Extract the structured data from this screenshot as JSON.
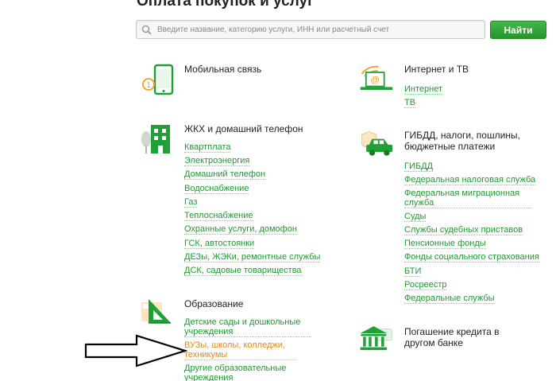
{
  "page": {
    "title": "Оплата покупок и услуг"
  },
  "search": {
    "placeholder": "Введите название, категорию услуги, ИНН или расчетный счет",
    "button_label": "Найти"
  },
  "colors": {
    "accent": "#21a038",
    "link": "#1f9a2f",
    "highlight": "#e08a10"
  },
  "categories": {
    "mobile": {
      "icon": "mobile-phone-icon",
      "title": "Мобильная связь",
      "links": []
    },
    "internet": {
      "icon": "laptop-at-icon",
      "title": "Интернет и ТВ",
      "links": [
        "Интернет",
        "ТВ"
      ]
    },
    "housing": {
      "icon": "building-icon",
      "title": "ЖКХ и домашний телефон",
      "links": [
        "Квартплата",
        "Электроэнергия",
        "Домашний телефон",
        "Водоснабжение",
        "Газ",
        "Теплоснабжение",
        "Охранные услуги, домофон",
        "ГСК, автостоянки",
        "ДЕЗы, ЖЭКи, ремонтные службы",
        "ДСК, садовые товарищества"
      ]
    },
    "gibdd": {
      "icon": "car-icon",
      "title": "ГИБДД, налоги, пошлины, бюджетные платежи",
      "links": [
        "ГИБДД",
        "Федеральная налоговая служба",
        "Федеральная миграционная служба",
        "Суды",
        "Службы судебных приставов",
        "Пенсионные фонды",
        "Фонды социального страхования",
        "БТИ",
        "Росреестр",
        "Федеральные службы"
      ]
    },
    "education": {
      "icon": "triangle-ruler-icon",
      "title": "Образование",
      "links": [
        "Детские сады и дошкольные учреждения",
        "ВУЗы, школы, колледжи, техникумы",
        "Другие образовательные учреждения"
      ]
    },
    "credit": {
      "icon": "bank-icon",
      "title": "Погашение кредита в другом банке",
      "links": []
    }
  }
}
